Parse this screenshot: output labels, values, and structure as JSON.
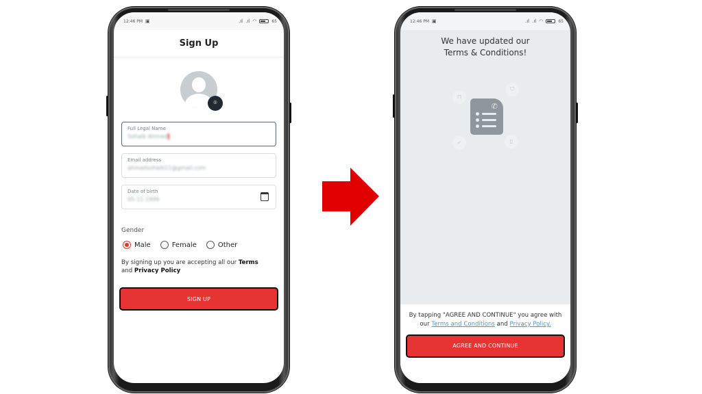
{
  "status_bar": {
    "time": "12:46 PM",
    "battery": "65"
  },
  "signup_screen": {
    "title": "Sign Up",
    "camera_icon": "add-photo-icon",
    "fields": [
      {
        "label": "Full Legal Name",
        "value": "Sohaib Ahmad"
      },
      {
        "label": "Email address",
        "value": "ahmadsohaib11@gmail.com"
      },
      {
        "label": "Date of birth",
        "value": "05-11-1999"
      }
    ],
    "gender": {
      "label": "Gender",
      "options": [
        "Male",
        "Female",
        "Other"
      ],
      "selected": "Male"
    },
    "terms_prefix": "By signing up you are accepting all our ",
    "terms_link": "Terms",
    "terms_and": " and ",
    "privacy_link": "Privacy Policy",
    "button_label": "SIGN UP"
  },
  "flow_arrow": {
    "color": "#e00000"
  },
  "terms_screen": {
    "title_line1": "We have updated our",
    "title_line2": "Terms & Conditions!",
    "footer_prefix": "By tapping \"AGREE AND CONTINUE\" you agree with our ",
    "terms_link": "Terms and Conditions",
    "footer_and": " and ",
    "privacy_link": "Privacy Policy.",
    "button_label": "AGREE AND CONTINUE"
  },
  "colors": {
    "primary": "#e63333",
    "link": "#5a8fd8",
    "terms_bg": "#e9ecee"
  }
}
